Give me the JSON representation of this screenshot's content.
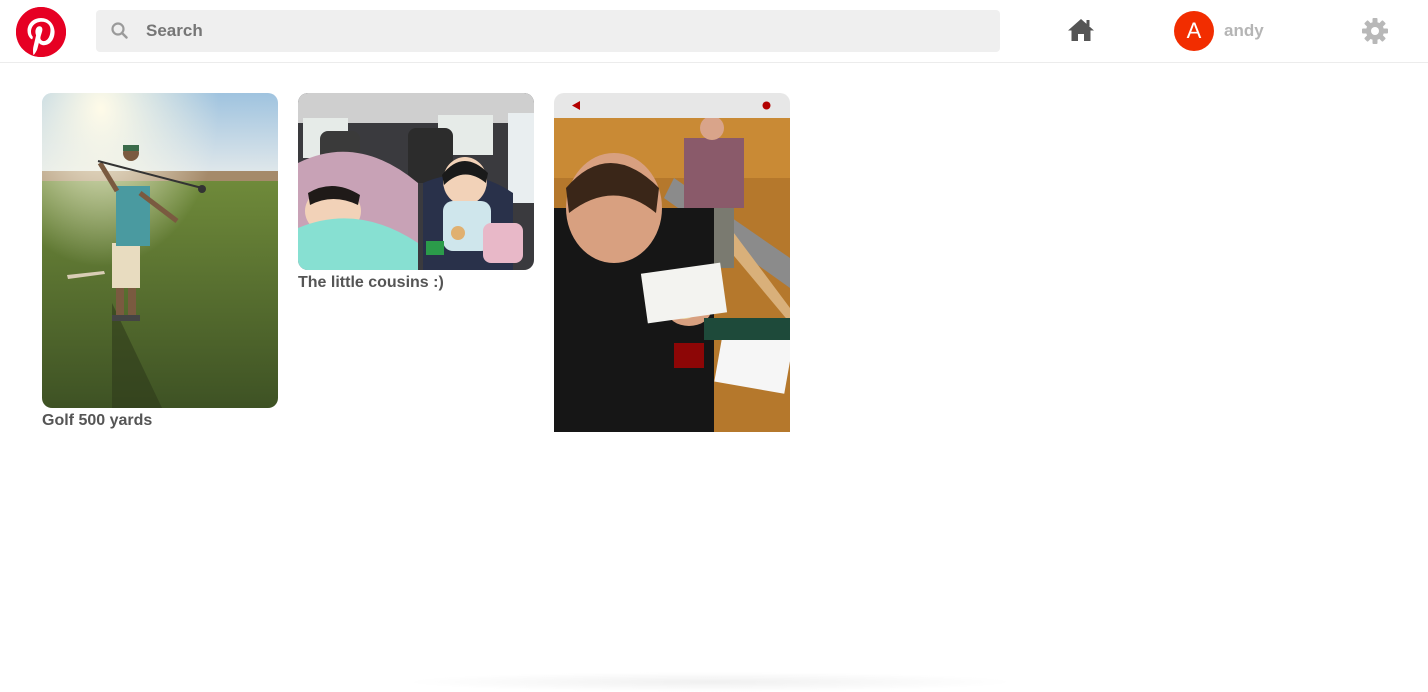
{
  "header": {
    "search_placeholder": "Search",
    "user": {
      "initial": "A",
      "name": "andy"
    }
  },
  "pins": [
    {
      "caption": "Golf 500 yards",
      "photo": "man swinging golf club on grass field at sunset"
    },
    {
      "caption": "The little cousins :)",
      "photo": "two small children sleeping in car seats"
    },
    {
      "caption": "",
      "photo": "students in lecture hall with professor standing"
    }
  ],
  "icons": {
    "logo": "pinterest-logo",
    "search": "search-icon",
    "home": "home-icon",
    "settings": "gear-icon",
    "video_control_left": "play-reverse-icon",
    "video_control_right": "record-dot-icon"
  },
  "colors": {
    "brand": "#e60023",
    "avatar": "#f22d00",
    "search_bg": "#efefef"
  }
}
